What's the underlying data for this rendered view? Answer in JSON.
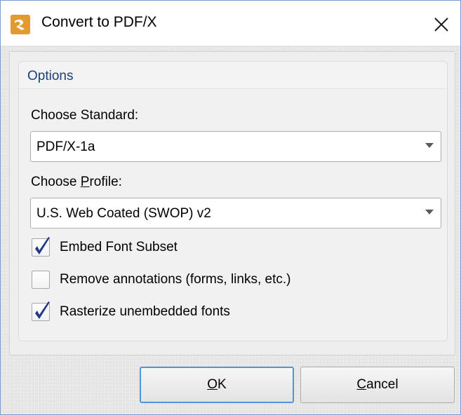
{
  "window": {
    "title": "Convert to PDF/X",
    "close_icon": "close-icon",
    "app_icon": "pdf-xchange-logo-icon"
  },
  "options": {
    "group_title": "Options",
    "standard": {
      "label": "Choose Standard:",
      "value": "PDF/X-1a"
    },
    "profile": {
      "label_prefix": "Choose ",
      "label_accel": "P",
      "label_suffix": "rofile:",
      "value": "U.S. Web Coated (SWOP) v2"
    },
    "checkboxes": [
      {
        "label": "Embed Font Subset",
        "checked": true
      },
      {
        "label": "Remove annotations (forms, links, etc.)",
        "checked": false
      },
      {
        "label": "Rasterize unembedded fonts",
        "checked": true
      }
    ]
  },
  "buttons": {
    "ok_accel": "O",
    "ok_rest": "K",
    "cancel_accel": "C",
    "cancel_rest": "ancel"
  },
  "colors": {
    "accent": "#4f95d8",
    "group_title": "#1c3f74",
    "checkmark": "#1e3a8a"
  }
}
